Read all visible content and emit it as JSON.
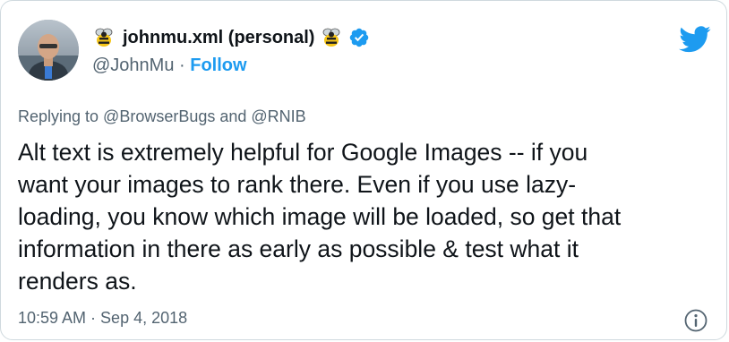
{
  "user": {
    "display_name": "johnmu.xml (personal)",
    "handle": "@JohnMu",
    "separator": " · ",
    "follow_label": "Follow",
    "avatar": "profile-photo",
    "name_prefix_icon": "bee-icon",
    "name_suffix_icon": "bee-icon",
    "verified_icon": "verified-badge-icon"
  },
  "brand": {
    "logo": "twitter-bird-icon",
    "accent_color": "#1d9bf0"
  },
  "tweet": {
    "replying_to": "Replying to @BrowserBugs and @RNIB",
    "text_lines": [
      "Alt text is extremely helpful for Google Images -- if you",
      "want your images to rank there. Even if you use lazy-",
      "loading, you know which image will be loaded, so get that",
      "information in there as early as possible & test what it",
      "renders as."
    ],
    "timestamp": "10:59 AM · Sep 4, 2018",
    "info_icon": "info-icon"
  }
}
